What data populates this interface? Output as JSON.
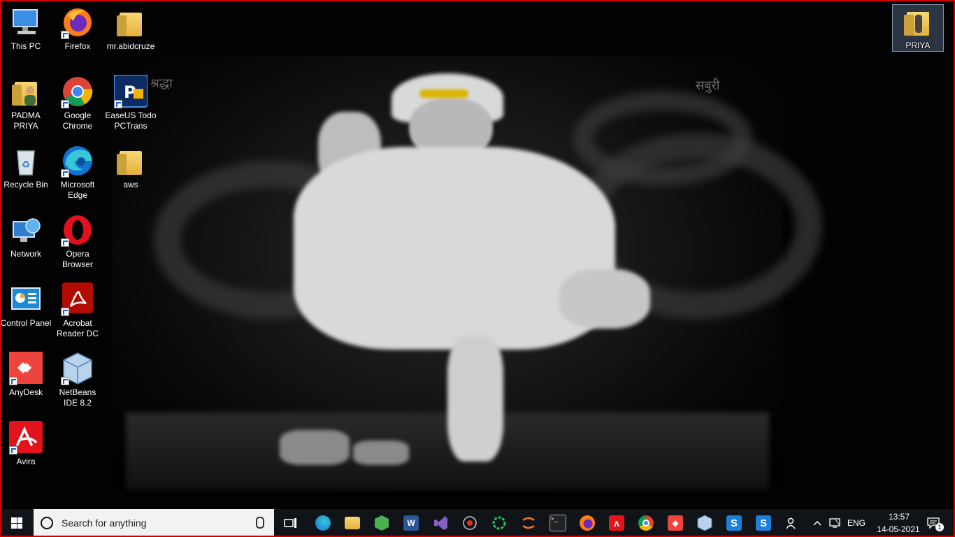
{
  "desktop": {
    "icons_left": [
      {
        "label": "This PC",
        "icon": "this-pc-icon"
      },
      {
        "label": "PADMA PRIYA",
        "icon": "user-folder-icon"
      },
      {
        "label": "Recycle Bin",
        "icon": "recycle-bin-icon"
      },
      {
        "label": "Network",
        "icon": "network-icon"
      },
      {
        "label": "Control Panel",
        "icon": "control-panel-icon"
      },
      {
        "label": "AnyDesk",
        "icon": "anydesk-icon"
      },
      {
        "label": "Avira",
        "icon": "avira-icon"
      }
    ],
    "icons_mid": [
      {
        "label": "Firefox",
        "icon": "firefox-icon"
      },
      {
        "label": "Google Chrome",
        "icon": "chrome-icon"
      },
      {
        "label": "Microsoft Edge",
        "icon": "edge-icon"
      },
      {
        "label": "Opera Browser",
        "icon": "opera-icon"
      },
      {
        "label": "Acrobat Reader DC",
        "icon": "acrobat-icon"
      },
      {
        "label": "NetBeans IDE 8.2",
        "icon": "netbeans-icon"
      }
    ],
    "icons_right": [
      {
        "label": "mr.abidcruze",
        "icon": "folder-icon"
      },
      {
        "label": "EaseUS Todo PCTrans",
        "icon": "easeus-icon"
      },
      {
        "label": "aws",
        "icon": "folder-icon"
      }
    ],
    "corner_icon": {
      "label": "PRIYA",
      "icon": "folder-icon"
    }
  },
  "taskbar": {
    "search_placeholder": "Search for anything",
    "pinned": [
      "task-view-icon",
      "edge-icon",
      "file-explorer-icon",
      "cube-app-icon",
      "word-icon",
      "visual-studio-icon",
      "spider-app-icon",
      "green-ring-icon",
      "jupyter-icon",
      "terminal-icon",
      "firefox-icon",
      "avira-icon",
      "chrome-icon",
      "anydesk-icon",
      "netbeans-icon",
      "s-app-icon",
      "s-app-icon-2"
    ],
    "tray": {
      "language": "ENG",
      "time": "13:57",
      "date": "14-05-2021",
      "notifications": "1"
    }
  },
  "colors": {
    "taskbar": "#101418",
    "frame": "#d00000",
    "accent": "#9cc7ef"
  }
}
